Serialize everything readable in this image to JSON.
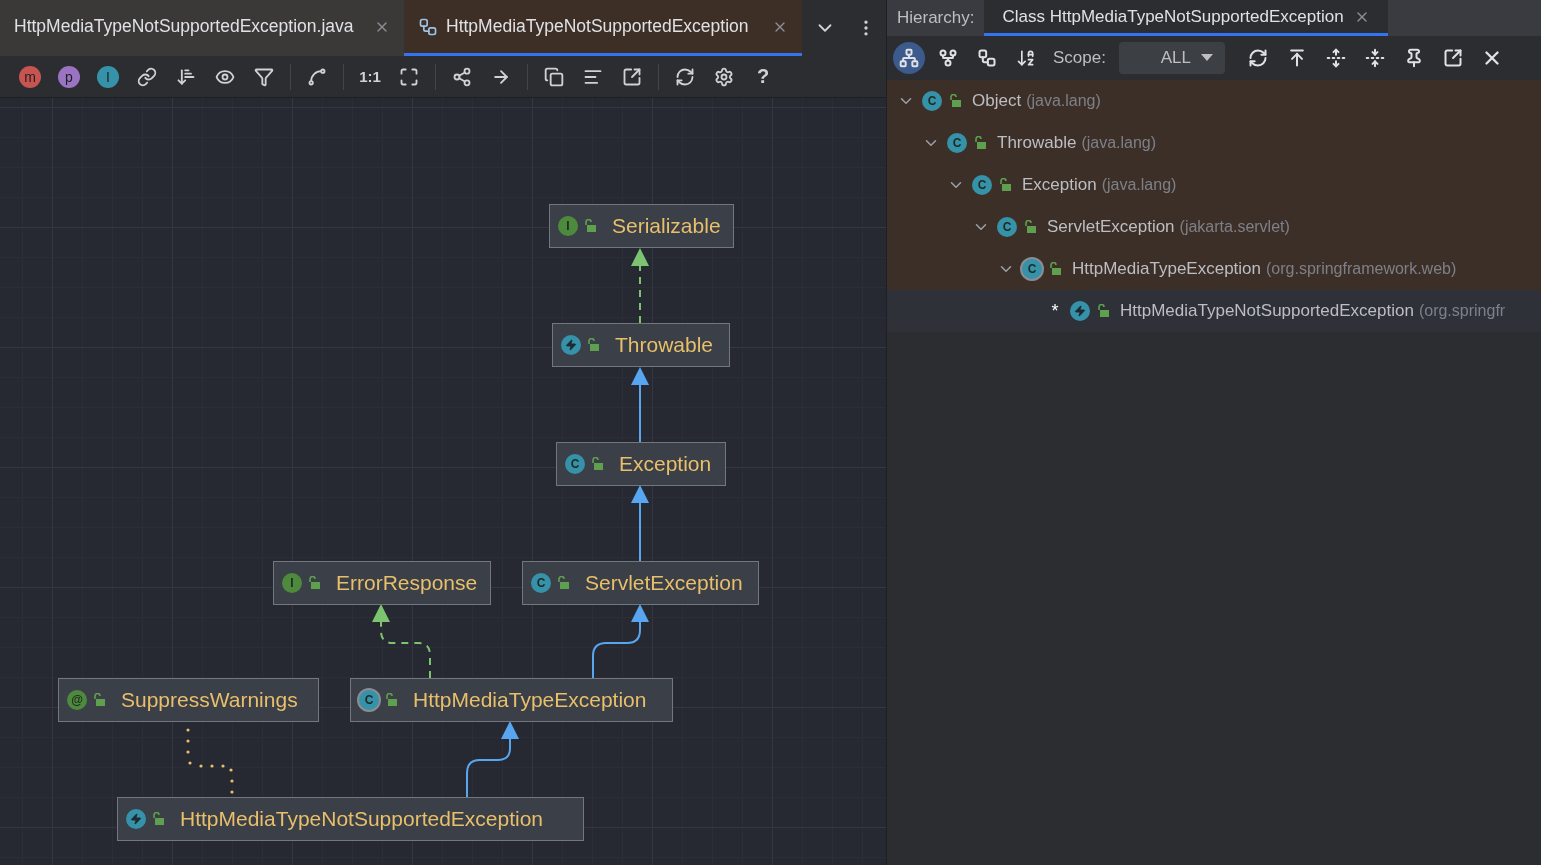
{
  "editor_tabs": [
    {
      "label": "HttpMediaTypeNotSupportedException.java",
      "selected": false,
      "kind": "file"
    },
    {
      "label": "HttpMediaTypeNotSupportedException",
      "selected": true,
      "kind": "diagram"
    }
  ],
  "diagram_toolbar": {
    "badges": [
      {
        "label": "m",
        "color": "#c75450"
      },
      {
        "label": "p",
        "color": "#9a73c2"
      },
      {
        "label": "I",
        "color": "#3592a8"
      }
    ],
    "zoom_label": "1:1",
    "help_label": "?"
  },
  "diagram": {
    "nodes": [
      {
        "name": "Serializable",
        "kind": "interface",
        "badge": "I"
      },
      {
        "name": "Throwable",
        "kind": "exception"
      },
      {
        "name": "Exception",
        "kind": "class",
        "badge": "C"
      },
      {
        "name": "ErrorResponse",
        "kind": "interface",
        "badge": "I"
      },
      {
        "name": "ServletException",
        "kind": "class",
        "badge": "C"
      },
      {
        "name": "SuppressWarnings",
        "kind": "annotation",
        "badge": "@"
      },
      {
        "name": "HttpMediaTypeException",
        "kind": "abstract",
        "badge": "C"
      },
      {
        "name": "HttpMediaTypeNotSupportedException",
        "kind": "exception"
      }
    ],
    "edges": [
      {
        "kind": "implements"
      },
      {
        "kind": "extends"
      },
      {
        "kind": "extends"
      },
      {
        "kind": "implements"
      },
      {
        "kind": "extends"
      },
      {
        "kind": "extends"
      },
      {
        "kind": "annotated"
      }
    ]
  },
  "hierarchy_panel": {
    "label": "Hierarchy:",
    "tab": {
      "label": "Class HttpMediaTypeNotSupportedException",
      "selected": true
    },
    "view_buttons": [
      {
        "selected": true
      },
      {
        "selected": false
      },
      {
        "selected": false
      }
    ],
    "scope_label": "Scope:",
    "scope_value": "ALL",
    "tree": [
      {
        "name": "Object",
        "package": "(java.lang)",
        "kind": "class",
        "badge": "C",
        "expanded": true,
        "selected": false,
        "children": [
          {
            "name": "Throwable",
            "package": "(java.lang)",
            "kind": "class",
            "badge": "C",
            "expanded": true,
            "selected": false,
            "children": [
              {
                "name": "Exception",
                "package": "(java.lang)",
                "kind": "class",
                "badge": "C",
                "expanded": true,
                "selected": false,
                "children": [
                  {
                    "name": "ServletException",
                    "package": "(jakarta.servlet)",
                    "kind": "class",
                    "badge": "C",
                    "expanded": true,
                    "selected": false,
                    "children": [
                      {
                        "name": "HttpMediaTypeException",
                        "package": "(org.springframework.web)",
                        "kind": "abstract",
                        "badge": "C",
                        "expanded": true,
                        "selected": false,
                        "children": [
                          {
                            "marker": "*",
                            "name": "HttpMediaTypeNotSupportedException",
                            "package": "(org.springfr",
                            "kind": "exception",
                            "selected": true
                          }
                        ]
                      }
                    ]
                  }
                ]
              }
            ]
          }
        ]
      }
    ]
  }
}
